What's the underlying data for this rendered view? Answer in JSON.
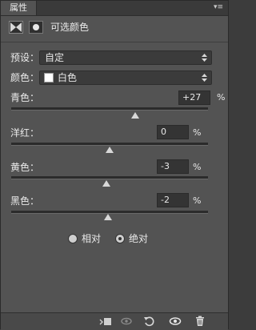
{
  "panel": {
    "tab_label": "属性",
    "tab_menu_icon": "panel-menu-icon"
  },
  "header": {
    "title": "可选颜色",
    "icons": [
      "adjustment-mask-icon",
      "layer-mask-icon"
    ]
  },
  "preset": {
    "label": "预设：",
    "value": "自定"
  },
  "colors": {
    "label": "颜色：",
    "value": "白色",
    "swatch_color": "#ffffff"
  },
  "sliders": [
    {
      "label": "青色：",
      "value": "+27",
      "unit": "%",
      "level": 0.63
    },
    {
      "label": "洋红：",
      "value": "0",
      "unit": "%",
      "level": 0.5
    },
    {
      "label": "黄色：",
      "value": "-3",
      "unit": "%",
      "level": 0.485
    },
    {
      "label": "黑色：",
      "value": "-2",
      "unit": "%",
      "level": 0.49
    }
  ],
  "method": {
    "options": [
      {
        "label": "相对",
        "selected": false
      },
      {
        "label": "绝对",
        "selected": true
      }
    ]
  },
  "toolbar": {
    "icons": [
      "clip-to-layer-icon",
      "view-previous-icon",
      "reset-icon",
      "visibility-eye-icon",
      "delete-trash-icon"
    ]
  }
}
